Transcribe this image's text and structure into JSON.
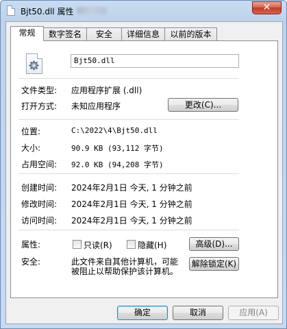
{
  "window": {
    "title": "Bjt50.dll 属性",
    "close_glyph": "✕"
  },
  "tabs": [
    {
      "label": "常规",
      "active": true
    },
    {
      "label": "数字签名",
      "active": false
    },
    {
      "label": "安全",
      "active": false
    },
    {
      "label": "详细信息",
      "active": false
    },
    {
      "label": "以前的版本",
      "active": false
    }
  ],
  "general": {
    "file_name": "Bjt50.dll",
    "file_type_label": "文件类型:",
    "file_type_value": "应用程序扩展 (.dll)",
    "opens_with_label": "打开方式:",
    "opens_with_value": "未知应用程序",
    "change_button": "更改(C)...",
    "location_label": "位置:",
    "location_value": "C:\\2022\\4\\Bjt50.dll",
    "size_label": "大小:",
    "size_value": "90.9 KB (93,112 字节)",
    "size_on_disk_label": "占用空间:",
    "size_on_disk_value": "92.0 KB (94,208 字节)",
    "created_label": "创建时间:",
    "created_value": "2024年2月1日 今天, 1 分钟之前",
    "modified_label": "修改时间:",
    "modified_value": "2024年2月1日 今天, 1 分钟之前",
    "accessed_label": "访问时间:",
    "accessed_value": "2024年2月1日 今天, 1 分钟之前",
    "attributes_label": "属性:",
    "readonly_label": "只读(R)",
    "hidden_label": "隐藏(H)",
    "advanced_button": "高级(D)...",
    "security_label": "安全:",
    "security_text_line1": "此文件来自其他计算机，可能",
    "security_text_line2": "被阻止以帮助保护该计算机。",
    "unblock_button": "解除锁定(K)"
  },
  "footer": {
    "ok_button": "确定",
    "cancel_button": "取消",
    "apply_button": "应用(A)"
  },
  "icons": {
    "app": "dll-file-icon",
    "file": "dll-file-gear-icon"
  },
  "colors": {
    "title_bar": "#c6daf0",
    "close_button": "#c23a23",
    "dialog_bg": "#f0f0f0",
    "default_button_border": "#3c7fb1"
  }
}
